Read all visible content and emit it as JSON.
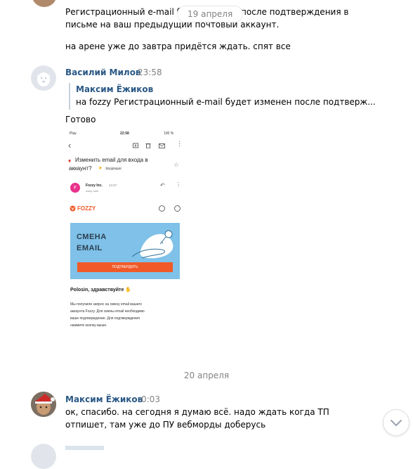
{
  "top_message": {
    "line1_a": "Регистрационный e-mail б",
    "line1_b": "после подтверждения в",
    "line2": "письме на ваш предыдущий почтовый аккаунт.",
    "line3": "на арене уже до завтра придётся ждать. спят все"
  },
  "date_pill_1": "19 апреля",
  "message_vasiliy": {
    "author": "Василий Милов",
    "time": "23:58",
    "reply_author": "Максим Ёжиков",
    "reply_text": "на fozzy Регистрационный e-mail будет изменен после подтверж...",
    "text": "Готово"
  },
  "screenshot": {
    "status_left": "Play",
    "status_time": "22:58",
    "status_right": "100 %",
    "subject_line1": "Изменить email для входа в",
    "subject_line2": "аккаунт?",
    "inbox_label": "Входящие",
    "sender_name": "Fozzy Inc.",
    "sender_time": "22:57",
    "sender_to": "кому: мне",
    "avatar_letter": "F",
    "brand": "FOZZY",
    "banner_line1": "СМЕНА",
    "banner_line2": "EMAIL",
    "confirm_button": "ПОДТВЕРДИТЬ",
    "greeting": "Polosin, здравствуйте",
    "body_line1": "Мы получили запрос на смену email вашего",
    "body_line2": "аккаунта Fozzy. Для смены email необходимо",
    "body_line3": "ваше подтверждение. Для подтверждения",
    "body_line4": "нажмите кнопку выше."
  },
  "date_separator_2": "20 апреля",
  "message_maxim": {
    "author": "Максим Ёжиков",
    "time": "0:03",
    "line1": "ок, спасибо. на сегодня я думаю всё. надо ждать когда ТП",
    "line2": "отпишет, там уже до ПУ вебморды доберусь"
  },
  "colors": {
    "link": "#2a5885",
    "muted": "#828282",
    "fozzy_orange": "#f05a28",
    "banner_blue": "#7fc1e8"
  }
}
